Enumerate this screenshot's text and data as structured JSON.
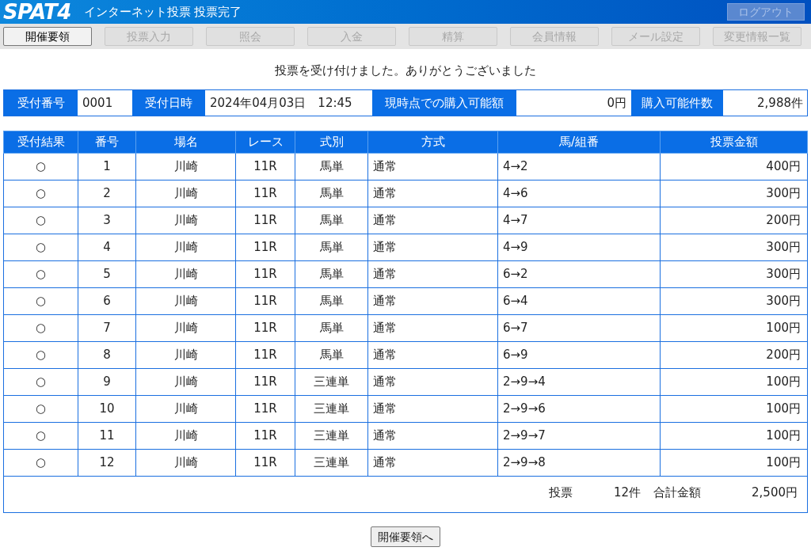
{
  "header": {
    "logo": "SPAT4",
    "title": "インターネット投票 投票完了",
    "logout": {
      "label": "ログアウト",
      "disabled": true
    }
  },
  "nav": [
    {
      "label": "開催要領",
      "disabled": false
    },
    {
      "label": "投票入力",
      "disabled": true
    },
    {
      "label": "照会",
      "disabled": true
    },
    {
      "label": "入金",
      "disabled": true
    },
    {
      "label": "精算",
      "disabled": true
    },
    {
      "label": "会員情報",
      "disabled": true
    },
    {
      "label": "メール設定",
      "disabled": true
    },
    {
      "label": "変更情報一覧",
      "disabled": true
    }
  ],
  "message": "投票を受け付けました。ありがとうございました",
  "info": [
    {
      "label": "受付番号",
      "value": "0001"
    },
    {
      "label": "受付日時",
      "value": "2024年04月03日　12:45"
    },
    {
      "label": "現時点での購入可能額",
      "value": "0円"
    },
    {
      "label": "購入可能件数",
      "value": "2,988件"
    }
  ],
  "table": {
    "columns": [
      "受付結果",
      "番号",
      "場名",
      "レース",
      "式別",
      "方式",
      "馬/組番",
      "投票金額"
    ],
    "rows": [
      [
        "○",
        "1",
        "川崎",
        "11R",
        "馬単",
        "通常",
        "4→2",
        "400円"
      ],
      [
        "○",
        "2",
        "川崎",
        "11R",
        "馬単",
        "通常",
        "4→6",
        "300円"
      ],
      [
        "○",
        "3",
        "川崎",
        "11R",
        "馬単",
        "通常",
        "4→7",
        "200円"
      ],
      [
        "○",
        "4",
        "川崎",
        "11R",
        "馬単",
        "通常",
        "4→9",
        "300円"
      ],
      [
        "○",
        "5",
        "川崎",
        "11R",
        "馬単",
        "通常",
        "6→2",
        "300円"
      ],
      [
        "○",
        "6",
        "川崎",
        "11R",
        "馬単",
        "通常",
        "6→4",
        "300円"
      ],
      [
        "○",
        "7",
        "川崎",
        "11R",
        "馬単",
        "通常",
        "6→7",
        "100円"
      ],
      [
        "○",
        "8",
        "川崎",
        "11R",
        "馬単",
        "通常",
        "6→9",
        "200円"
      ],
      [
        "○",
        "9",
        "川崎",
        "11R",
        "三連単",
        "通常",
        "2→9→4",
        "100円"
      ],
      [
        "○",
        "10",
        "川崎",
        "11R",
        "三連単",
        "通常",
        "2→9→6",
        "100円"
      ],
      [
        "○",
        "11",
        "川崎",
        "11R",
        "三連単",
        "通常",
        "2→9→7",
        "100円"
      ],
      [
        "○",
        "12",
        "川崎",
        "11R",
        "三連単",
        "通常",
        "2→9→8",
        "100円"
      ]
    ],
    "summary": {
      "count_label": "投票",
      "count": "12件",
      "total_label": "合計金額",
      "total": "2,500円"
    }
  },
  "bottom_button": "開催要領へ"
}
